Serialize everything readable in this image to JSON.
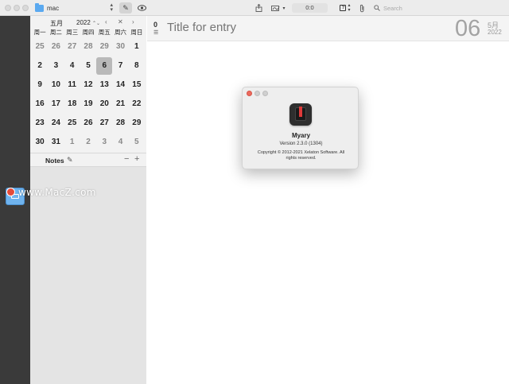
{
  "toolbar": {
    "folder_name": "mac",
    "counter": "0:0",
    "search_placeholder": "Search",
    "question_glyph": "?"
  },
  "calendar": {
    "month": "五月",
    "year": "2022",
    "weekdays": [
      "周一",
      "周二",
      "周三",
      "周四",
      "周五",
      "周六",
      "周日"
    ],
    "weeks": [
      [
        {
          "d": "25",
          "o": true
        },
        {
          "d": "26",
          "o": true
        },
        {
          "d": "27",
          "o": true
        },
        {
          "d": "28",
          "o": true
        },
        {
          "d": "29",
          "o": true
        },
        {
          "d": "30",
          "o": true
        },
        {
          "d": "1",
          "o": false
        }
      ],
      [
        {
          "d": "2",
          "o": false
        },
        {
          "d": "3",
          "o": false
        },
        {
          "d": "4",
          "o": false
        },
        {
          "d": "5",
          "o": false
        },
        {
          "d": "6",
          "o": false,
          "s": true
        },
        {
          "d": "7",
          "o": false
        },
        {
          "d": "8",
          "o": false
        }
      ],
      [
        {
          "d": "9",
          "o": false
        },
        {
          "d": "10",
          "o": false
        },
        {
          "d": "11",
          "o": false
        },
        {
          "d": "12",
          "o": false
        },
        {
          "d": "13",
          "o": false
        },
        {
          "d": "14",
          "o": false
        },
        {
          "d": "15",
          "o": false
        }
      ],
      [
        {
          "d": "16",
          "o": false
        },
        {
          "d": "17",
          "o": false
        },
        {
          "d": "18",
          "o": false
        },
        {
          "d": "19",
          "o": false
        },
        {
          "d": "20",
          "o": false
        },
        {
          "d": "21",
          "o": false
        },
        {
          "d": "22",
          "o": false
        }
      ],
      [
        {
          "d": "23",
          "o": false
        },
        {
          "d": "24",
          "o": false
        },
        {
          "d": "25",
          "o": false
        },
        {
          "d": "26",
          "o": false
        },
        {
          "d": "27",
          "o": false
        },
        {
          "d": "28",
          "o": false
        },
        {
          "d": "29",
          "o": false
        }
      ],
      [
        {
          "d": "30",
          "o": false
        },
        {
          "d": "31",
          "o": false
        },
        {
          "d": "1",
          "o": true
        },
        {
          "d": "2",
          "o": true
        },
        {
          "d": "3",
          "o": true
        },
        {
          "d": "4",
          "o": true
        },
        {
          "d": "5",
          "o": true
        }
      ]
    ]
  },
  "notes": {
    "label": "Notes"
  },
  "editor": {
    "entry_count": "0",
    "title_placeholder": "Title for entry",
    "day": "06",
    "month": "5月",
    "year": "2022"
  },
  "about": {
    "app_name": "Myary",
    "version": "Version 2.3.0 (1304)",
    "copyright": "Copyright © 2012-2021 Xelaton Software. All rights reserved."
  },
  "watermark": {
    "text": "www.MacZ.com"
  },
  "colors": {
    "accent_red": "#e03a3a",
    "close_button": "#ec6a5e",
    "folder_blue": "#5aa9f0"
  },
  "icons": [
    "folder-icon",
    "pencil-icon",
    "eye-icon",
    "share-icon",
    "signature-icon",
    "clip-icon",
    "search-icon",
    "list-icon"
  ]
}
